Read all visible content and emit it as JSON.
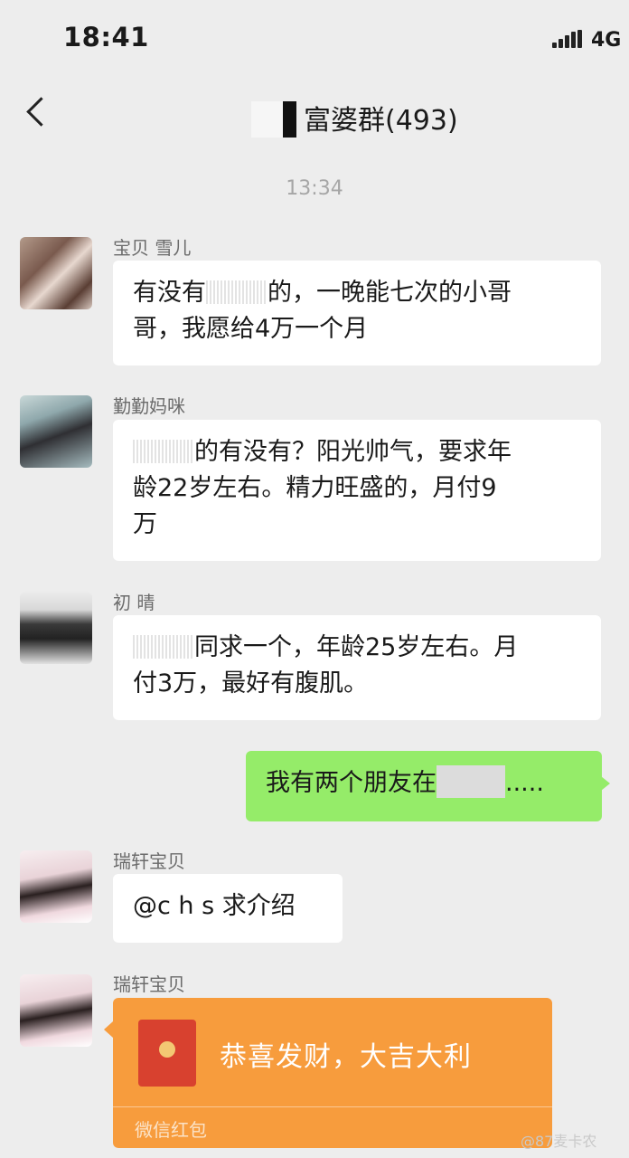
{
  "status_bar": {
    "time": "18:41",
    "network": "4G"
  },
  "header": {
    "title": "富婆群(493)"
  },
  "chat": {
    "timestamp": "13:34",
    "messages": [
      {
        "sender": "宝贝 雪儿",
        "line1_a": "有没有",
        "line1_b": "的，一晚能七次的小哥",
        "line2": "哥，我愿给4万一个月"
      },
      {
        "sender": "勤勤妈咪",
        "line1_b": "的有没有？阳光帅气，要求年",
        "line2": "龄22岁左右。精力旺盛的，月付9",
        "line3": "万"
      },
      {
        "sender": "初 晴",
        "line1_b": "同求一个，年龄25岁左右。月",
        "line2": "付3万，最好有腹肌。"
      },
      {
        "outgoing": true,
        "text_a": "我有两个朋友在",
        "text_b": "....."
      },
      {
        "sender": "瑞轩宝贝",
        "text": "@c h s 求介绍"
      },
      {
        "sender": "瑞轩宝贝",
        "redpacket": {
          "greeting": "恭喜发财，大吉大利",
          "label": "微信红包"
        }
      }
    ]
  },
  "watermark": "@87麦卡农"
}
